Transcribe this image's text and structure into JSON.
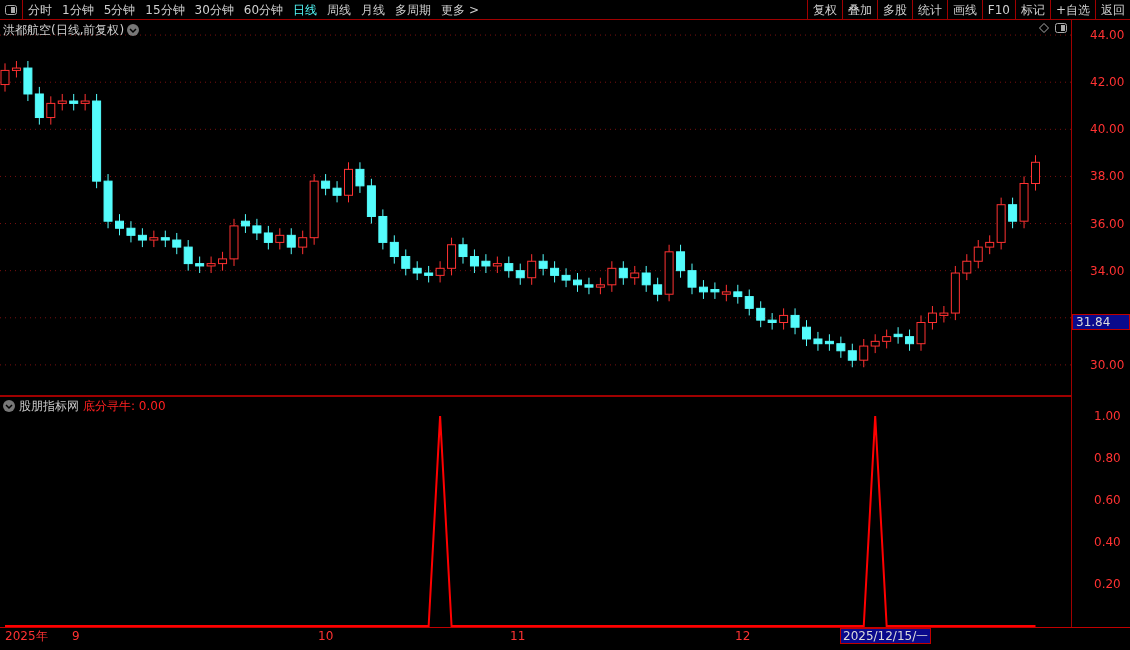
{
  "toolbar": {
    "periods": [
      {
        "label": "分时",
        "selected": false
      },
      {
        "label": "1分钟",
        "selected": false
      },
      {
        "label": "5分钟",
        "selected": false
      },
      {
        "label": "15分钟",
        "selected": false
      },
      {
        "label": "30分钟",
        "selected": false
      },
      {
        "label": "60分钟",
        "selected": false
      },
      {
        "label": "日线",
        "selected": true
      },
      {
        "label": "周线",
        "selected": false
      },
      {
        "label": "月线",
        "selected": false
      },
      {
        "label": "多周期",
        "selected": false
      }
    ],
    "more": "更多 >",
    "buttons": [
      "复权",
      "叠加",
      "多股",
      "统计",
      "画线",
      "F10",
      "标记",
      "+自选",
      "返回"
    ]
  },
  "price_pane": {
    "title": "洪都航空(日线,前复权)",
    "current_price": "31.84",
    "chart_data": {
      "type": "candlestick",
      "grid": true,
      "ylim": [
        28.68,
        44.64
      ],
      "yticks": [
        {
          "value": 44,
          "label": "44.00"
        },
        {
          "value": 42,
          "label": "42.00"
        },
        {
          "value": 40,
          "label": "40.00"
        },
        {
          "value": 38,
          "label": "38.00"
        },
        {
          "value": 36,
          "label": "36.00"
        },
        {
          "value": 34,
          "label": "34.00"
        },
        {
          "value": 30,
          "label": "30.00"
        }
      ],
      "categories": [
        null,
        null,
        null,
        null,
        null,
        null,
        null,
        null,
        null,
        null,
        null,
        null,
        null,
        null,
        null,
        null,
        null,
        null,
        null,
        null,
        null,
        null,
        null,
        null,
        null,
        null,
        null,
        null,
        null,
        null,
        null,
        null,
        null,
        null,
        null,
        null,
        null,
        null,
        null,
        null,
        null,
        null,
        null,
        null,
        null,
        null,
        null,
        null,
        null,
        null,
        null,
        null,
        null,
        null,
        null,
        null,
        null,
        null,
        null,
        null,
        null,
        null,
        null,
        null,
        null,
        null,
        null,
        null,
        null,
        null,
        null,
        null,
        null,
        null,
        null,
        null,
        null,
        null,
        null,
        null,
        null,
        null,
        null,
        null,
        null,
        null,
        null,
        null,
        null,
        null,
        null
      ],
      "ohlc": [
        [
          41.9,
          42.8,
          41.6,
          42.5
        ],
        [
          42.5,
          42.9,
          42.2,
          42.6
        ],
        [
          42.6,
          42.9,
          41.2,
          41.5
        ],
        [
          41.5,
          41.8,
          40.2,
          40.5
        ],
        [
          40.5,
          41.4,
          40.2,
          41.1
        ],
        [
          41.1,
          41.5,
          40.8,
          41.2
        ],
        [
          41.2,
          41.5,
          40.8,
          41.1
        ],
        [
          41.1,
          41.5,
          40.8,
          41.2
        ],
        [
          41.2,
          41.5,
          37.5,
          37.8
        ],
        [
          37.8,
          38.1,
          35.8,
          36.1
        ],
        [
          36.1,
          36.4,
          35.5,
          35.8
        ],
        [
          35.8,
          36.1,
          35.2,
          35.5
        ],
        [
          35.5,
          35.8,
          35.0,
          35.3
        ],
        [
          35.3,
          35.7,
          35.0,
          35.4
        ],
        [
          35.4,
          35.7,
          35.0,
          35.3
        ],
        [
          35.3,
          35.6,
          34.7,
          35.0
        ],
        [
          35.0,
          35.3,
          34.0,
          34.3
        ],
        [
          34.3,
          34.6,
          33.9,
          34.2
        ],
        [
          34.2,
          34.6,
          33.9,
          34.3
        ],
        [
          34.3,
          34.8,
          34.0,
          34.5
        ],
        [
          34.5,
          36.2,
          34.2,
          35.9
        ],
        [
          36.1,
          36.4,
          35.6,
          35.9
        ],
        [
          35.9,
          36.2,
          35.3,
          35.6
        ],
        [
          35.6,
          35.9,
          34.9,
          35.2
        ],
        [
          35.2,
          35.8,
          34.9,
          35.5
        ],
        [
          35.5,
          35.8,
          34.7,
          35.0
        ],
        [
          35.0,
          35.7,
          34.7,
          35.4
        ],
        [
          35.4,
          38.1,
          35.1,
          37.8
        ],
        [
          37.8,
          38.1,
          37.2,
          37.5
        ],
        [
          37.5,
          37.8,
          36.9,
          37.2
        ],
        [
          37.2,
          38.6,
          36.9,
          38.3
        ],
        [
          38.3,
          38.6,
          37.3,
          37.6
        ],
        [
          37.6,
          37.9,
          36.0,
          36.3
        ],
        [
          36.3,
          36.6,
          34.9,
          35.2
        ],
        [
          35.2,
          35.5,
          34.3,
          34.6
        ],
        [
          34.6,
          34.9,
          33.8,
          34.1
        ],
        [
          34.1,
          34.4,
          33.6,
          33.9
        ],
        [
          33.9,
          34.2,
          33.5,
          33.8
        ],
        [
          33.8,
          34.4,
          33.5,
          34.1
        ],
        [
          34.1,
          35.4,
          33.8,
          35.1
        ],
        [
          35.1,
          35.4,
          34.3,
          34.6
        ],
        [
          34.6,
          34.9,
          33.9,
          34.2
        ],
        [
          34.4,
          34.7,
          33.9,
          34.2
        ],
        [
          34.2,
          34.6,
          33.9,
          34.3
        ],
        [
          34.3,
          34.6,
          33.7,
          34.0
        ],
        [
          34.0,
          34.3,
          33.4,
          33.7
        ],
        [
          33.7,
          34.7,
          33.4,
          34.4
        ],
        [
          34.4,
          34.7,
          33.8,
          34.1
        ],
        [
          34.1,
          34.4,
          33.5,
          33.8
        ],
        [
          33.8,
          34.1,
          33.3,
          33.6
        ],
        [
          33.6,
          33.9,
          33.1,
          33.4
        ],
        [
          33.4,
          33.7,
          33.0,
          33.3
        ],
        [
          33.3,
          33.7,
          33.0,
          33.4
        ],
        [
          33.4,
          34.4,
          33.1,
          34.1
        ],
        [
          34.1,
          34.4,
          33.4,
          33.7
        ],
        [
          33.7,
          34.2,
          33.4,
          33.9
        ],
        [
          33.9,
          34.2,
          33.1,
          33.4
        ],
        [
          33.4,
          33.7,
          32.7,
          33.0
        ],
        [
          33.0,
          35.1,
          32.7,
          34.8
        ],
        [
          34.8,
          35.1,
          33.7,
          34.0
        ],
        [
          34.0,
          34.3,
          33.0,
          33.3
        ],
        [
          33.3,
          33.6,
          32.8,
          33.1
        ],
        [
          33.2,
          33.5,
          32.8,
          33.1
        ],
        [
          33.0,
          33.4,
          32.7,
          33.1
        ],
        [
          33.1,
          33.4,
          32.6,
          32.9
        ],
        [
          32.9,
          33.2,
          32.1,
          32.4
        ],
        [
          32.4,
          32.7,
          31.6,
          31.9
        ],
        [
          31.9,
          32.2,
          31.5,
          31.8
        ],
        [
          31.8,
          32.4,
          31.5,
          32.1
        ],
        [
          32.1,
          32.4,
          31.3,
          31.6
        ],
        [
          31.6,
          31.9,
          30.8,
          31.1
        ],
        [
          31.1,
          31.4,
          30.6,
          30.9
        ],
        [
          31.0,
          31.3,
          30.6,
          30.9
        ],
        [
          30.9,
          31.2,
          30.3,
          30.6
        ],
        [
          30.6,
          30.9,
          29.9,
          30.2
        ],
        [
          30.2,
          31.1,
          29.9,
          30.8
        ],
        [
          30.8,
          31.3,
          30.5,
          31.0
        ],
        [
          31.0,
          31.5,
          30.7,
          31.2
        ],
        [
          31.3,
          31.6,
          30.9,
          31.2
        ],
        [
          31.2,
          31.5,
          30.6,
          30.9
        ],
        [
          30.9,
          32.1,
          30.6,
          31.8
        ],
        [
          31.8,
          32.5,
          31.5,
          32.2
        ],
        [
          32.1,
          32.5,
          31.8,
          32.2
        ],
        [
          32.2,
          34.2,
          31.9,
          33.9
        ],
        [
          33.9,
          34.7,
          33.6,
          34.4
        ],
        [
          34.4,
          35.3,
          34.1,
          35.0
        ],
        [
          35.0,
          35.5,
          34.7,
          35.2
        ],
        [
          35.2,
          37.1,
          34.9,
          36.8
        ],
        [
          36.8,
          37.1,
          35.8,
          36.1
        ],
        [
          36.1,
          38.0,
          35.8,
          37.7
        ],
        [
          37.7,
          38.9,
          37.4,
          38.6
        ]
      ]
    }
  },
  "indicator_pane": {
    "source": "股朋指标网",
    "indicator": "底分寻牛: 0.00",
    "chart_data": {
      "type": "line",
      "ylim": [
        0,
        1.095
      ],
      "yticks": [
        {
          "value": 1,
          "label": "1.00"
        },
        {
          "value": 0.8,
          "label": "0.80"
        },
        {
          "value": 0.6,
          "label": "0.60"
        },
        {
          "value": 0.4,
          "label": "0.40"
        },
        {
          "value": 0.2,
          "label": "0.20"
        }
      ],
      "categories": [
        null,
        null,
        null,
        null,
        null,
        null,
        null,
        null,
        null,
        null,
        null,
        null,
        null,
        null,
        null,
        null,
        null,
        null,
        null,
        null,
        null,
        null,
        null,
        null,
        null,
        null,
        null,
        null,
        null,
        null,
        null,
        null,
        null,
        null,
        null,
        null,
        null,
        null,
        null,
        null,
        null,
        null,
        null,
        null,
        null,
        null,
        null,
        null,
        null,
        null,
        null,
        null,
        null,
        null,
        null,
        null,
        null,
        null,
        null,
        null,
        null,
        null,
        null,
        null,
        null,
        null,
        null,
        null,
        null,
        null,
        null,
        null,
        null,
        null,
        null,
        null,
        null,
        null,
        null,
        null,
        null,
        null,
        null,
        null,
        null,
        null,
        null,
        null,
        null,
        null,
        null
      ],
      "series": [
        {
          "color": "#ff0000",
          "values": [
            0,
            0,
            0,
            0,
            0,
            0,
            0,
            0,
            0,
            0,
            0,
            0,
            0,
            0,
            0,
            0,
            0,
            0,
            0,
            0,
            0,
            0,
            0,
            0,
            0,
            0,
            0,
            0,
            0,
            0,
            0,
            0,
            0,
            0,
            0,
            0,
            0,
            0,
            1,
            0,
            0,
            0,
            0,
            0,
            0,
            0,
            0,
            0,
            0,
            0,
            0,
            0,
            0,
            0,
            0,
            0,
            0,
            0,
            0,
            0,
            0,
            0,
            0,
            0,
            0,
            0,
            0,
            0,
            0,
            0,
            0,
            0,
            0,
            0,
            0,
            0,
            1,
            0,
            0,
            0,
            0,
            0,
            0,
            0,
            0,
            0,
            0,
            0,
            0,
            0,
            0
          ]
        }
      ]
    }
  },
  "date_axis": {
    "labels": [
      "2025年",
      "9",
      "10",
      "11",
      "12"
    ],
    "cursor_date": "2025/12/15/一"
  }
}
